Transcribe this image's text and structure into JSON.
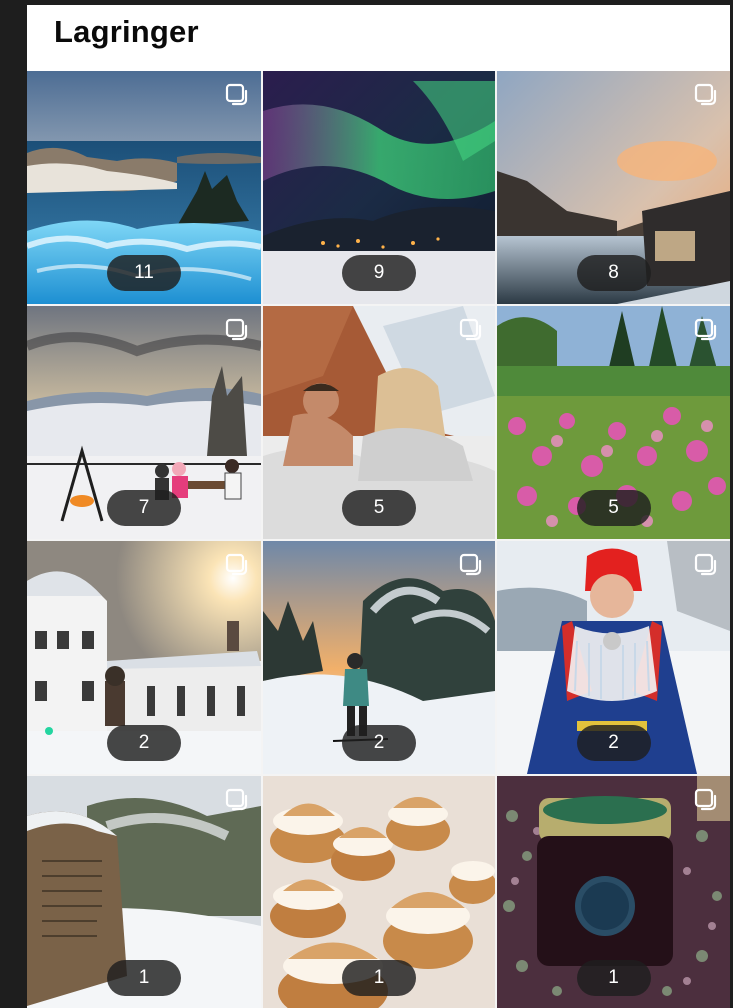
{
  "header": {
    "title": "Lagringer"
  },
  "collections": [
    {
      "count": "11",
      "scene": "coast-jacuzzi"
    },
    {
      "count": "9",
      "scene": "northern-lights"
    },
    {
      "count": "8",
      "scene": "fjord-cabin"
    },
    {
      "count": "7",
      "scene": "winter-terrace"
    },
    {
      "count": "5",
      "scene": "couple-bed"
    },
    {
      "count": "5",
      "scene": "flower-garden"
    },
    {
      "count": "2",
      "scene": "manor-snow"
    },
    {
      "count": "2",
      "scene": "skier-sunset"
    },
    {
      "count": "2",
      "scene": "sami-costume"
    },
    {
      "count": "1",
      "scene": "stone-monument"
    },
    {
      "count": "1",
      "scene": "semla-buns"
    },
    {
      "count": "1",
      "scene": "jam-jar"
    }
  ],
  "icons": {
    "tile_badge": "multi-photo-stack-icon"
  },
  "colors": {
    "badge_bg": "#1e1e1e",
    "page_bg": "#1e1e1e",
    "header_bg": "#ffffff"
  }
}
